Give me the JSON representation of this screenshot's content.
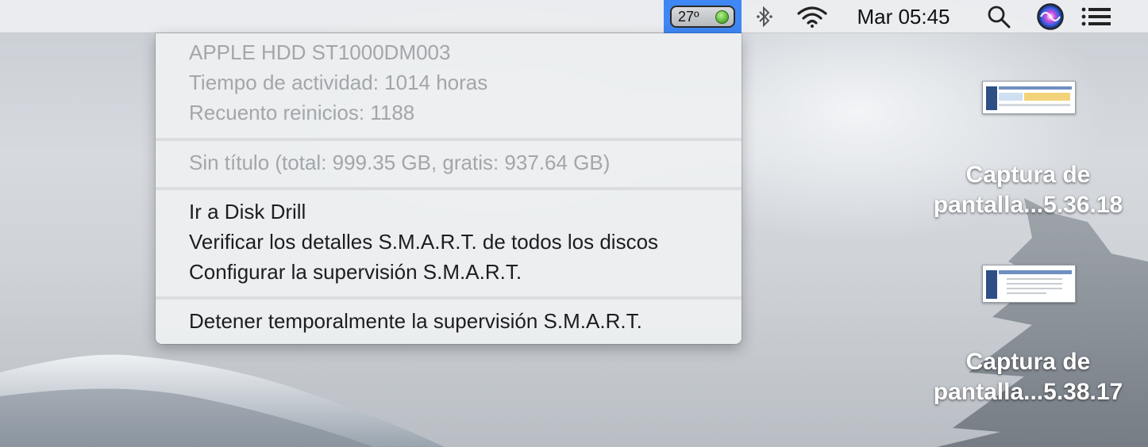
{
  "menubar": {
    "temperature": "27º",
    "temperature_status_color": "#57b22e",
    "highlight_color": "#3f87f4",
    "bluetooth_icon": "bluetooth-icon",
    "wifi_icon": "wifi-icon",
    "clock": "Mar 05:45",
    "search_icon": "spotlight-search-icon",
    "siri_icon": "siri-icon",
    "list_icon": "notification-center-icon"
  },
  "menu": {
    "disk_info": {
      "model": "APPLE HDD ST1000DM003",
      "uptime": "Tiempo de actividad: 1014 horas",
      "restarts": "Recuento reinicios: 1188"
    },
    "volume": "Sin título (total: 999.35 GB, gratis: 937.64 GB)",
    "actions": [
      {
        "label": "Ir a Disk Drill"
      },
      {
        "label": "Verificar los detalles S.M.A.R.T. de todos los discos"
      },
      {
        "label": "Configurar la supervisión S.M.A.R.T."
      }
    ],
    "pause": "Detener temporalmente la supervisión S.M.A.R.T."
  },
  "desktop": {
    "files": [
      {
        "line1": "Captura de",
        "line2": "pantalla...5.36.18"
      },
      {
        "line1": "Captura de",
        "line2": "pantalla...5.38.17"
      }
    ]
  }
}
